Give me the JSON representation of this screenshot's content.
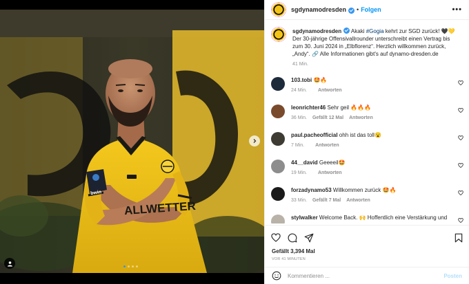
{
  "post": {
    "username": "sgdynamodresden",
    "header_separator": "•",
    "follow_label": "Folgen",
    "more_label": "•••"
  },
  "caption": {
    "username": "sgdynamodresden",
    "part1": " Akaki ",
    "hashtag": "#Gogia",
    "part2": " kehrt zur SGD zurück! 🖤💛 Der 30-jährige Offensivallrounder unterschreibt einen Vertrag bis zum 30. Juni 2024 in „Elbflorenz“. Herzlich willkommen zurück, „Andy“. 🔗 Alle Informationen gibt's auf dynamo-dresden.de",
    "time": "41 Min."
  },
  "comments": [
    {
      "user": "103.tobi",
      "text": " 🤩🔥",
      "time": "24 Min.",
      "likes": "",
      "reply": "Antworten",
      "avatar_color": "#1c2a3a"
    },
    {
      "user": "leonrichter46",
      "text": " Sehr geil 🔥🔥🔥",
      "time": "36 Min.",
      "likes": "Gefällt 12 Mal",
      "reply": "Antworten",
      "avatar_color": "#7a4a2c"
    },
    {
      "user": "paul.pacheofficial",
      "text": " ohh ist das toll😮",
      "time": "7 Min.",
      "likes": "",
      "reply": "Antworten",
      "avatar_color": "#3d3b32"
    },
    {
      "user": "44__david",
      "text": " Geeeeil🤩",
      "time": "19 Min.",
      "likes": "",
      "reply": "Antworten",
      "avatar_color": "#8d8d8d"
    },
    {
      "user": "forzadynamo53",
      "text": " Willkommen zurück 🤩🔥",
      "time": "33 Min.",
      "likes": "Gefällt 7 Mal",
      "reply": "Antworten",
      "avatar_color": "#1a1a1a"
    },
    {
      "user": "stylwalker",
      "text": " Welcome Back. 🙌 Hoffentlich eine Verstärkung und",
      "time": "",
      "likes": "",
      "reply": "",
      "avatar_color": "#b9b2a8"
    }
  ],
  "actions": {
    "likes_text": "Gefällt 3,394 Mal",
    "time_text": "VOR 41 MINUTEN",
    "comment_placeholder": "Kommentieren ...",
    "post_label": "Posten"
  },
  "photo": {
    "jersey_sponsor": "ALLWETTER",
    "sleeve_text": "bwin",
    "carousel_count": 4,
    "carousel_active": 1
  },
  "colors": {
    "accent": "#0095f6",
    "jersey_yellow": "#f2c318",
    "wall_yellow": "#e9c233"
  }
}
